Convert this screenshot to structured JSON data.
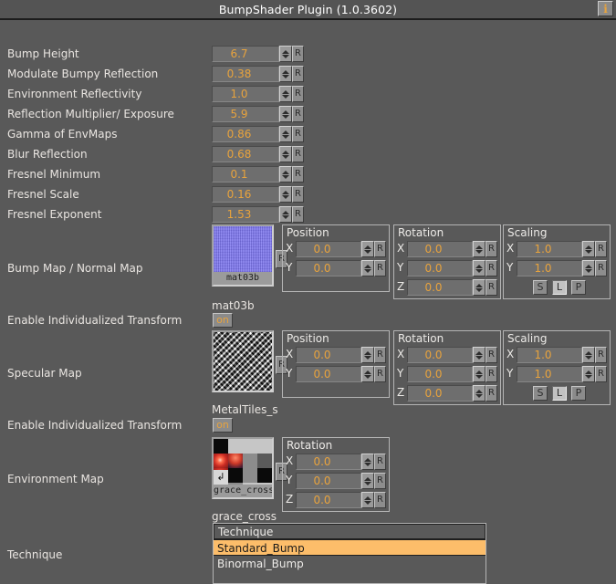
{
  "window": {
    "title": "BumpShader Plugin (1.0.3602)",
    "info_icon": "i",
    "accent_color": "#e8a33d",
    "panel_bg": "#595959",
    "highlight_color": "#fcbd6a"
  },
  "sliders": [
    {
      "label": "Bump Height",
      "value": "6.7",
      "reset": "R"
    },
    {
      "label": "Modulate Bumpy Reflection",
      "value": "0.38",
      "reset": "R"
    },
    {
      "label": "Environment Reflectivity",
      "value": "1.0",
      "reset": "R"
    },
    {
      "label": "Reflection Multiplier/ Exposure",
      "value": "5.9",
      "reset": "R"
    },
    {
      "label": "Gamma of EnvMaps",
      "value": "0.86",
      "reset": "R"
    },
    {
      "label": "Blur Reflection",
      "value": "0.68",
      "reset": "R"
    },
    {
      "label": "Fresnel Minimum",
      "value": "0.1",
      "reset": "R"
    },
    {
      "label": "Fresnel Scale",
      "value": "0.16",
      "reset": "R"
    },
    {
      "label": "Fresnel Exponent",
      "value": "1.53",
      "reset": "R"
    }
  ],
  "bump_map": {
    "label": "Bump Map / Normal Map",
    "thumb_caption": "mat03b",
    "texture_name": "mat03b",
    "reload": "R",
    "position": {
      "title": "Position",
      "axes": [
        {
          "axis": "X",
          "value": "0.0",
          "reset": "R"
        },
        {
          "axis": "Y",
          "value": "0.0",
          "reset": "R"
        }
      ]
    },
    "rotation": {
      "title": "Rotation",
      "axes": [
        {
          "axis": "X",
          "value": "0.0",
          "reset": "R"
        },
        {
          "axis": "Y",
          "value": "0.0",
          "reset": "R"
        },
        {
          "axis": "Z",
          "value": "0.0",
          "reset": "R"
        }
      ]
    },
    "scaling": {
      "title": "Scaling",
      "axes": [
        {
          "axis": "X",
          "value": "1.0",
          "reset": "R"
        },
        {
          "axis": "Y",
          "value": "1.0",
          "reset": "R"
        }
      ],
      "modes": [
        {
          "label": "S",
          "active": false
        },
        {
          "label": "L",
          "active": true
        },
        {
          "label": "P",
          "active": false
        }
      ]
    },
    "individual_transform": {
      "label": "Enable Individualized Transform",
      "state": "on"
    }
  },
  "specular_map": {
    "label": "Specular Map",
    "texture_name": "MetalTiles_s",
    "reload": "R",
    "position": {
      "title": "Position",
      "axes": [
        {
          "axis": "X",
          "value": "0.0",
          "reset": "R"
        },
        {
          "axis": "Y",
          "value": "0.0",
          "reset": "R"
        }
      ]
    },
    "rotation": {
      "title": "Rotation",
      "axes": [
        {
          "axis": "X",
          "value": "0.0",
          "reset": "R"
        },
        {
          "axis": "Y",
          "value": "0.0",
          "reset": "R"
        },
        {
          "axis": "Z",
          "value": "0.0",
          "reset": "R"
        }
      ]
    },
    "scaling": {
      "title": "Scaling",
      "axes": [
        {
          "axis": "X",
          "value": "1.0",
          "reset": "R"
        },
        {
          "axis": "Y",
          "value": "1.0",
          "reset": "R"
        }
      ],
      "modes": [
        {
          "label": "S",
          "active": false
        },
        {
          "label": "L",
          "active": true
        },
        {
          "label": "P",
          "active": false
        }
      ]
    },
    "individual_transform": {
      "label": "Enable Individualized Transform",
      "state": "on"
    }
  },
  "environment_map": {
    "label": "Environment Map",
    "thumb_caption": "grace_cross",
    "texture_name": "grace_cross",
    "reload": "R",
    "badge_icon": "reload-arrow-icon",
    "rotation": {
      "title": "Rotation",
      "axes": [
        {
          "axis": "X",
          "value": "0.0",
          "reset": "R"
        },
        {
          "axis": "Y",
          "value": "0.0",
          "reset": "R"
        },
        {
          "axis": "Z",
          "value": "0.0",
          "reset": "R"
        }
      ]
    }
  },
  "technique": {
    "label": "Technique",
    "header": "Technique",
    "items": [
      {
        "label": "Standard_Bump",
        "selected": true
      },
      {
        "label": "Binormal_Bump",
        "selected": false
      }
    ]
  }
}
